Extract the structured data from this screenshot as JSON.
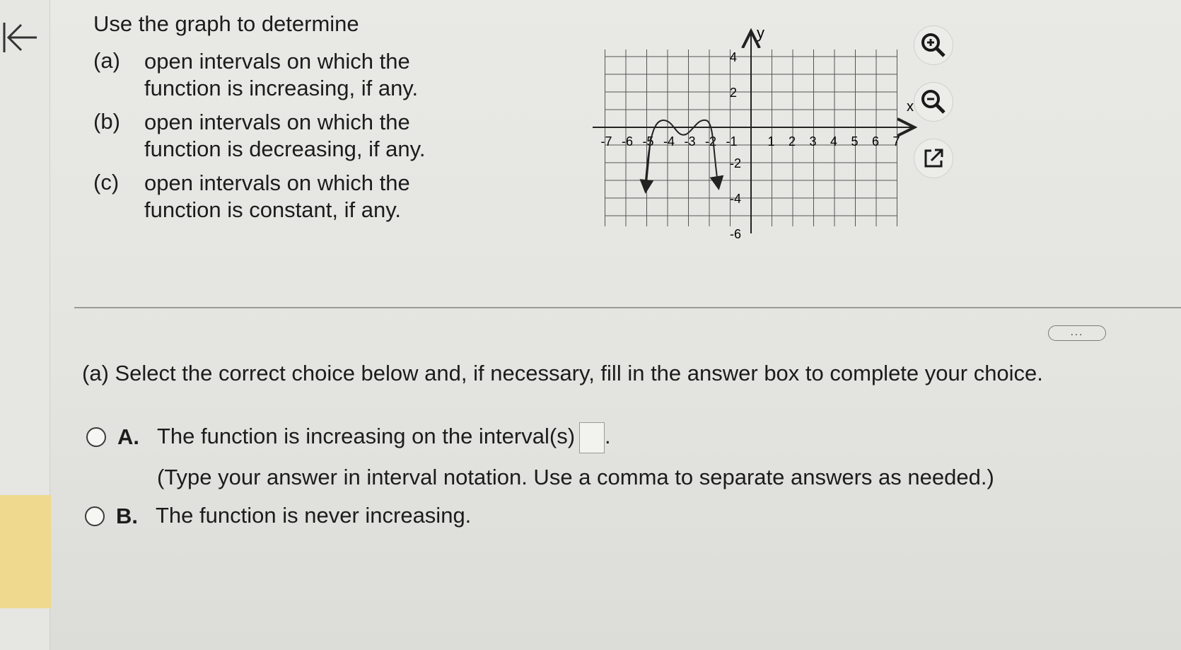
{
  "question": {
    "title": "Use the graph to determine",
    "parts": [
      {
        "letter": "(a)",
        "text": "open intervals on which the function is increasing, if any."
      },
      {
        "letter": "(b)",
        "text": "open intervals on which the function is decreasing, if any."
      },
      {
        "letter": "(c)",
        "text": "open intervals on which the function is constant, if any."
      }
    ]
  },
  "graph": {
    "x_axis_label": "x",
    "y_axis_label": "y",
    "x_ticks": [
      "-7",
      "-6",
      "-5",
      "-4",
      "-3",
      "-2",
      "-1",
      "1",
      "2",
      "3",
      "4",
      "5",
      "6",
      "7"
    ],
    "y_ticks": [
      "4",
      "2",
      "-2",
      "-4",
      "-6"
    ]
  },
  "tools": {
    "zoom_in": "zoom-in-icon",
    "zoom_out": "zoom-out-icon",
    "popout": "external-link-icon"
  },
  "more_label": "...",
  "part_a": {
    "instruction": "(a) Select the correct choice below and, if necessary, fill in the answer box to complete your choice.",
    "choices": [
      {
        "letter": "A.",
        "text": "The function is increasing on the interval(s)",
        "punctuation": ".",
        "note": "(Type your answer in interval notation. Use a comma to separate answers as needed.)"
      },
      {
        "letter": "B.",
        "text": "The function is never increasing."
      }
    ]
  },
  "colors": {
    "background": "#e6e6e2",
    "highlight": "#efd98f",
    "text": "#1c1c1c"
  }
}
